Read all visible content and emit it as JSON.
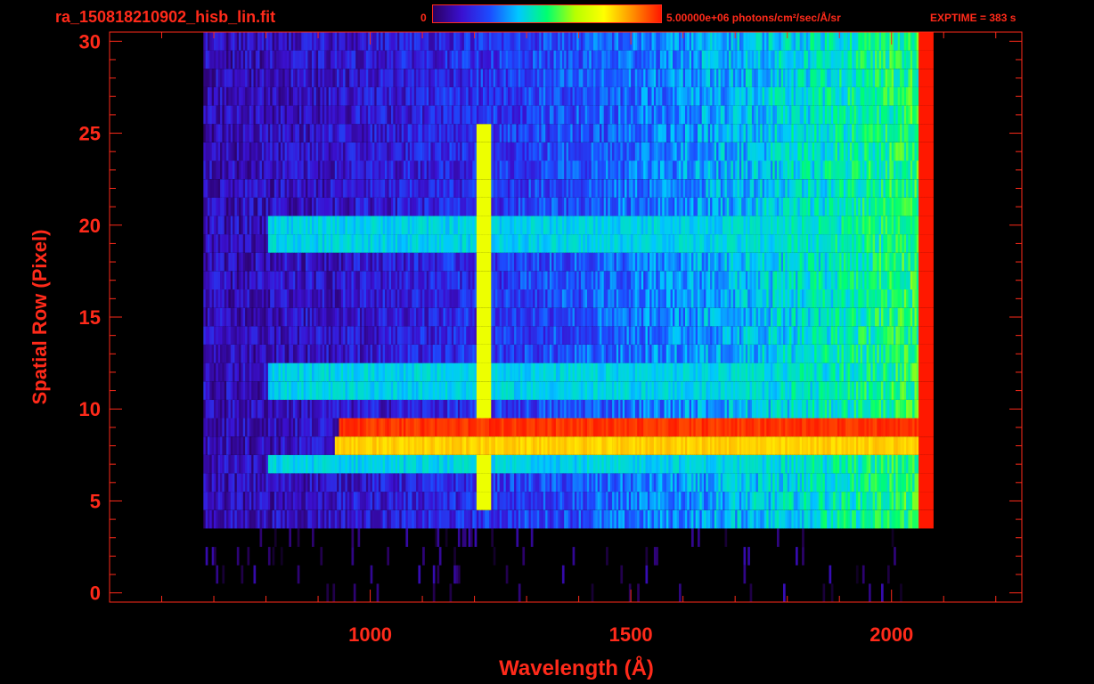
{
  "header": {
    "filename": "ra_150818210902_hisb_lin.fit",
    "colorbar_min": "0",
    "colorbar_max_label": "5.00000e+06 photons/cm²/sec/Å/sr",
    "exptime": "EXPTIME = 383 s"
  },
  "colors": {
    "text": "#ff2a1a",
    "background": "#000000",
    "colormap": [
      "#000000",
      "#2a0060",
      "#3a10d0",
      "#1c4cff",
      "#00c8ff",
      "#00ff70",
      "#b8ff00",
      "#ffff00",
      "#ff9000",
      "#ff1800"
    ]
  },
  "chart_data": {
    "type": "heatmap",
    "title": "",
    "xlabel": "Wavelength (Å)",
    "ylabel": "Spatial Row (Pixel)",
    "xlim": [
      500,
      2250
    ],
    "ylim": [
      -0.5,
      30.5
    ],
    "x_ticks": [
      1000,
      1500,
      2000
    ],
    "y_ticks": [
      0,
      5,
      10,
      15,
      20,
      25,
      30
    ],
    "x_tick_labels": [
      "1000",
      "1500",
      "2000"
    ],
    "y_tick_labels": [
      "0",
      "5",
      "10",
      "15",
      "20",
      "25",
      "30"
    ],
    "colorbar": {
      "min": 0,
      "max": 5000000,
      "units": "photons/cm²/sec/Å/sr"
    },
    "rows": [
      0,
      30
    ],
    "approx_wavelength_coverage": [
      680,
      2080
    ],
    "features": [
      {
        "description": "bright horizontal band",
        "row": 9,
        "wavelength_range": [
          940,
          2070
        ],
        "level": 1.0
      },
      {
        "description": "bright horizontal band",
        "row": 8,
        "wavelength_range": [
          930,
          2070
        ],
        "level": 0.85
      },
      {
        "description": "Lyman-alpha vertical line",
        "wavelength": 1216,
        "rows": [
          5,
          25
        ],
        "level": 0.75
      },
      {
        "description": "red edge line",
        "wavelength": 2065,
        "rows": [
          0,
          30
        ],
        "level": 1.0
      }
    ]
  }
}
